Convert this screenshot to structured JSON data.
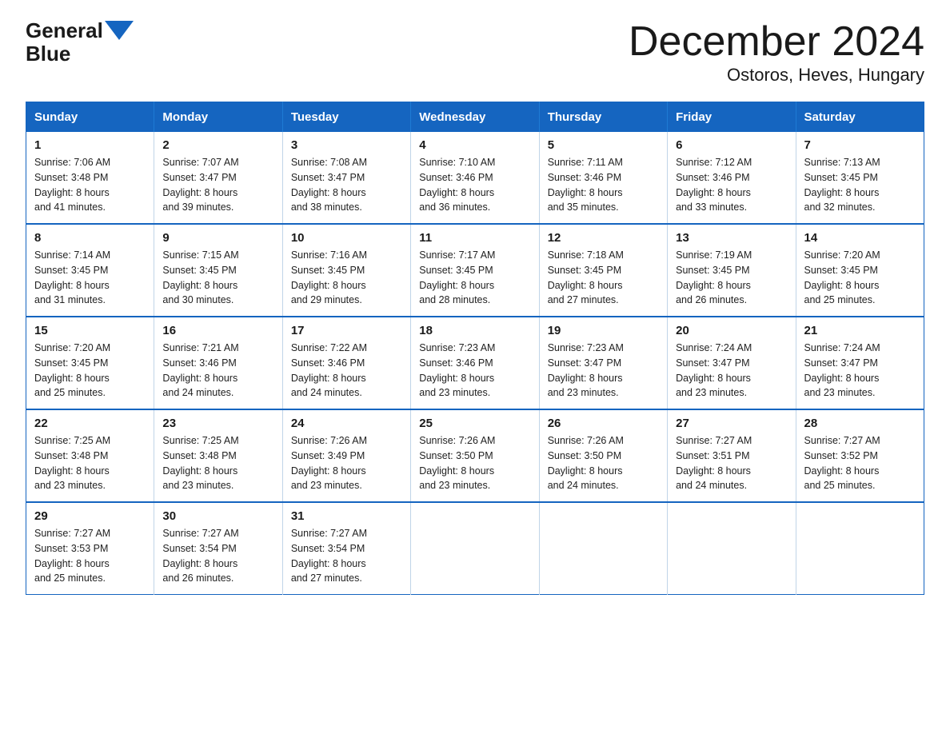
{
  "logo": {
    "part1": "General",
    "part2": "Blue"
  },
  "header": {
    "month": "December 2024",
    "location": "Ostoros, Heves, Hungary"
  },
  "days_of_week": [
    "Sunday",
    "Monday",
    "Tuesday",
    "Wednesday",
    "Thursday",
    "Friday",
    "Saturday"
  ],
  "weeks": [
    [
      {
        "day": "1",
        "sunrise": "7:06 AM",
        "sunset": "3:48 PM",
        "daylight": "8 hours and 41 minutes."
      },
      {
        "day": "2",
        "sunrise": "7:07 AM",
        "sunset": "3:47 PM",
        "daylight": "8 hours and 39 minutes."
      },
      {
        "day": "3",
        "sunrise": "7:08 AM",
        "sunset": "3:47 PM",
        "daylight": "8 hours and 38 minutes."
      },
      {
        "day": "4",
        "sunrise": "7:10 AM",
        "sunset": "3:46 PM",
        "daylight": "8 hours and 36 minutes."
      },
      {
        "day": "5",
        "sunrise": "7:11 AM",
        "sunset": "3:46 PM",
        "daylight": "8 hours and 35 minutes."
      },
      {
        "day": "6",
        "sunrise": "7:12 AM",
        "sunset": "3:46 PM",
        "daylight": "8 hours and 33 minutes."
      },
      {
        "day": "7",
        "sunrise": "7:13 AM",
        "sunset": "3:45 PM",
        "daylight": "8 hours and 32 minutes."
      }
    ],
    [
      {
        "day": "8",
        "sunrise": "7:14 AM",
        "sunset": "3:45 PM",
        "daylight": "8 hours and 31 minutes."
      },
      {
        "day": "9",
        "sunrise": "7:15 AM",
        "sunset": "3:45 PM",
        "daylight": "8 hours and 30 minutes."
      },
      {
        "day": "10",
        "sunrise": "7:16 AM",
        "sunset": "3:45 PM",
        "daylight": "8 hours and 29 minutes."
      },
      {
        "day": "11",
        "sunrise": "7:17 AM",
        "sunset": "3:45 PM",
        "daylight": "8 hours and 28 minutes."
      },
      {
        "day": "12",
        "sunrise": "7:18 AM",
        "sunset": "3:45 PM",
        "daylight": "8 hours and 27 minutes."
      },
      {
        "day": "13",
        "sunrise": "7:19 AM",
        "sunset": "3:45 PM",
        "daylight": "8 hours and 26 minutes."
      },
      {
        "day": "14",
        "sunrise": "7:20 AM",
        "sunset": "3:45 PM",
        "daylight": "8 hours and 25 minutes."
      }
    ],
    [
      {
        "day": "15",
        "sunrise": "7:20 AM",
        "sunset": "3:45 PM",
        "daylight": "8 hours and 25 minutes."
      },
      {
        "day": "16",
        "sunrise": "7:21 AM",
        "sunset": "3:46 PM",
        "daylight": "8 hours and 24 minutes."
      },
      {
        "day": "17",
        "sunrise": "7:22 AM",
        "sunset": "3:46 PM",
        "daylight": "8 hours and 24 minutes."
      },
      {
        "day": "18",
        "sunrise": "7:23 AM",
        "sunset": "3:46 PM",
        "daylight": "8 hours and 23 minutes."
      },
      {
        "day": "19",
        "sunrise": "7:23 AM",
        "sunset": "3:47 PM",
        "daylight": "8 hours and 23 minutes."
      },
      {
        "day": "20",
        "sunrise": "7:24 AM",
        "sunset": "3:47 PM",
        "daylight": "8 hours and 23 minutes."
      },
      {
        "day": "21",
        "sunrise": "7:24 AM",
        "sunset": "3:47 PM",
        "daylight": "8 hours and 23 minutes."
      }
    ],
    [
      {
        "day": "22",
        "sunrise": "7:25 AM",
        "sunset": "3:48 PM",
        "daylight": "8 hours and 23 minutes."
      },
      {
        "day": "23",
        "sunrise": "7:25 AM",
        "sunset": "3:48 PM",
        "daylight": "8 hours and 23 minutes."
      },
      {
        "day": "24",
        "sunrise": "7:26 AM",
        "sunset": "3:49 PM",
        "daylight": "8 hours and 23 minutes."
      },
      {
        "day": "25",
        "sunrise": "7:26 AM",
        "sunset": "3:50 PM",
        "daylight": "8 hours and 23 minutes."
      },
      {
        "day": "26",
        "sunrise": "7:26 AM",
        "sunset": "3:50 PM",
        "daylight": "8 hours and 24 minutes."
      },
      {
        "day": "27",
        "sunrise": "7:27 AM",
        "sunset": "3:51 PM",
        "daylight": "8 hours and 24 minutes."
      },
      {
        "day": "28",
        "sunrise": "7:27 AM",
        "sunset": "3:52 PM",
        "daylight": "8 hours and 25 minutes."
      }
    ],
    [
      {
        "day": "29",
        "sunrise": "7:27 AM",
        "sunset": "3:53 PM",
        "daylight": "8 hours and 25 minutes."
      },
      {
        "day": "30",
        "sunrise": "7:27 AM",
        "sunset": "3:54 PM",
        "daylight": "8 hours and 26 minutes."
      },
      {
        "day": "31",
        "sunrise": "7:27 AM",
        "sunset": "3:54 PM",
        "daylight": "8 hours and 27 minutes."
      },
      null,
      null,
      null,
      null
    ]
  ]
}
